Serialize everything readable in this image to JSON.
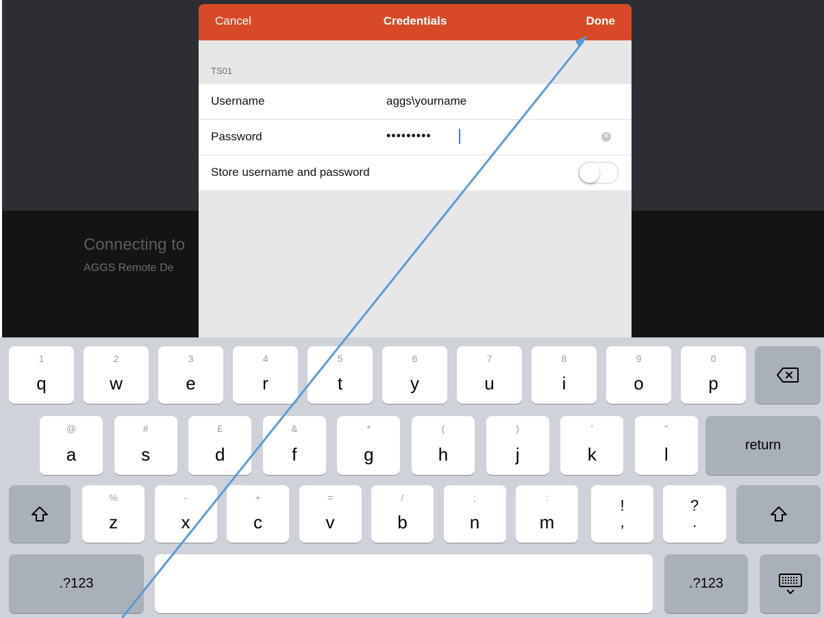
{
  "background": {
    "connecting_title": "Connecting to",
    "connecting_subtitle": "AGGS Remote De"
  },
  "dialog": {
    "cancel_label": "Cancel",
    "title": "Credentials",
    "done_label": "Done",
    "section_header": "TS01",
    "username_label": "Username",
    "username_value": "aggs\\yourname",
    "password_label": "Password",
    "password_value": "•••••••••",
    "store_label": "Store username and password",
    "store_enabled": false
  },
  "keyboard": {
    "row1": [
      {
        "sub": "1",
        "main": "q"
      },
      {
        "sub": "2",
        "main": "w"
      },
      {
        "sub": "3",
        "main": "e"
      },
      {
        "sub": "4",
        "main": "r"
      },
      {
        "sub": "5",
        "main": "t"
      },
      {
        "sub": "6",
        "main": "y"
      },
      {
        "sub": "7",
        "main": "u"
      },
      {
        "sub": "8",
        "main": "i"
      },
      {
        "sub": "9",
        "main": "o"
      },
      {
        "sub": "0",
        "main": "p"
      }
    ],
    "row2": [
      {
        "sub": "@",
        "main": "a"
      },
      {
        "sub": "#",
        "main": "s"
      },
      {
        "sub": "£",
        "main": "d"
      },
      {
        "sub": "&",
        "main": "f"
      },
      {
        "sub": "*",
        "main": "g"
      },
      {
        "sub": "(",
        "main": "h"
      },
      {
        "sub": ")",
        "main": "j"
      },
      {
        "sub": "'",
        "main": "k"
      },
      {
        "sub": "\"",
        "main": "l"
      }
    ],
    "row3": [
      {
        "sub": "%",
        "main": "z"
      },
      {
        "sub": "-",
        "main": "x"
      },
      {
        "sub": "+",
        "main": "c"
      },
      {
        "sub": "=",
        "main": "v"
      },
      {
        "sub": "/",
        "main": "b"
      },
      {
        "sub": ";",
        "main": "n"
      },
      {
        "sub": ":",
        "main": "m"
      }
    ],
    "punct1": {
      "top": "!",
      "bottom": ","
    },
    "punct2": {
      "top": "?",
      "bottom": "."
    },
    "return_label": "return",
    "numbers_label": ".?123"
  }
}
